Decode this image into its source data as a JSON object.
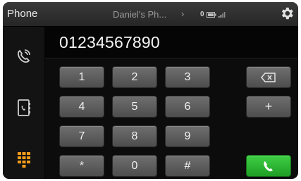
{
  "header": {
    "title": "Phone",
    "device_name": "Daniel's Ph...",
    "device_chevron": "›",
    "bluetooth_count": "0",
    "settings_icon": "gear-icon"
  },
  "sidebar": {
    "items": [
      {
        "name": "recent-calls",
        "icon": "phone-history-icon"
      },
      {
        "name": "contacts",
        "icon": "contacts-book-icon"
      },
      {
        "name": "keypad",
        "icon": "keypad-grid-icon",
        "active_color": "#f29b1a"
      }
    ]
  },
  "display": {
    "number": "01234567890"
  },
  "keypad": {
    "keys": [
      "1",
      "2",
      "3",
      "4",
      "5",
      "6",
      "7",
      "8",
      "9",
      "*",
      "0",
      "#"
    ],
    "backspace_icon": "backspace-icon",
    "plus_label": "+",
    "call_icon": "call-icon"
  },
  "colors": {
    "accent_orange": "#f29b1a",
    "call_green": "#2eb534",
    "key_gray": "#5f5f5f",
    "background": "#0c0c0c"
  }
}
